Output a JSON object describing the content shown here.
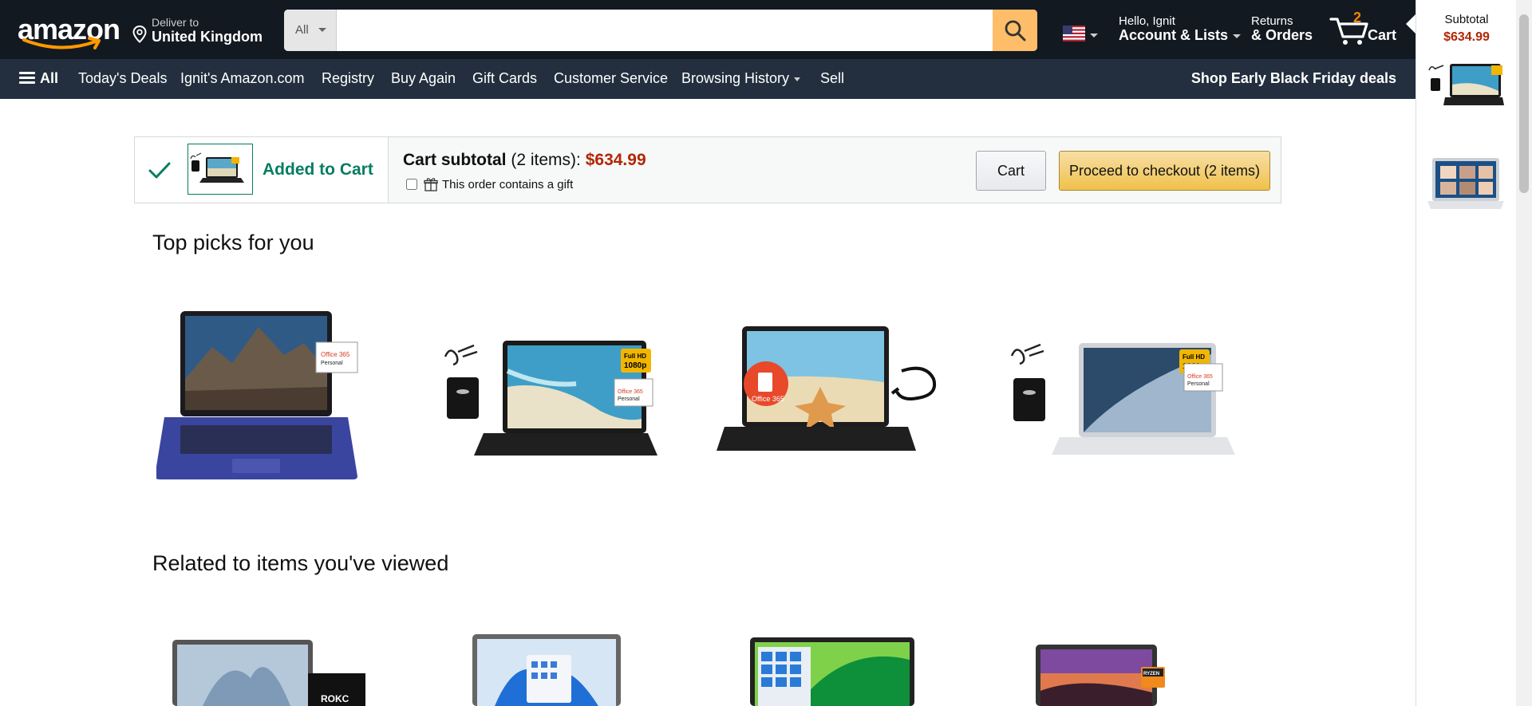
{
  "header": {
    "logo_text": "amazon",
    "deliver_line1": "Deliver to",
    "deliver_line2": "United Kingdom",
    "search_category": "All",
    "search_placeholder": "",
    "account_line1": "Hello, Ignit",
    "account_line2": "Account & Lists",
    "returns_line1": "Returns",
    "returns_line2": "& Orders",
    "cart_count": "2",
    "cart_label": "Cart"
  },
  "subnav": {
    "all_label": "All",
    "items": [
      "Today's Deals",
      "Ignit's Amazon.com",
      "Registry",
      "Buy Again",
      "Gift Cards",
      "Customer Service",
      "Browsing History",
      "Sell"
    ],
    "promo": "Shop Early Black Friday deals"
  },
  "added_to_cart": {
    "label": "Added to Cart",
    "subtotal_label": "Cart subtotal",
    "item_count_text": "(2 items):",
    "subtotal_price": "$634.99",
    "gift_label": "This order contains a gift",
    "cart_button": "Cart",
    "checkout_button": "Proceed to checkout (2 items)"
  },
  "sections": {
    "top_picks_title": "Top picks for you",
    "related_title": "Related to items you've viewed"
  },
  "side_cart": {
    "subtotal_label": "Subtotal",
    "subtotal_price": "$634.99"
  },
  "product_tags": {
    "office": "Office 365",
    "personal": "Personal",
    "full_hd": "Full HD",
    "res": "1080p",
    "rokc": "ROKC",
    "ryzen": "RYZEN"
  },
  "colors": {
    "nav_bg": "#131921",
    "subnav_bg": "#232f3e",
    "accent_orange": "#febd69",
    "success_green": "#067d62",
    "price_red": "#b12704",
    "checkout_yellow": "#f0c14b"
  }
}
